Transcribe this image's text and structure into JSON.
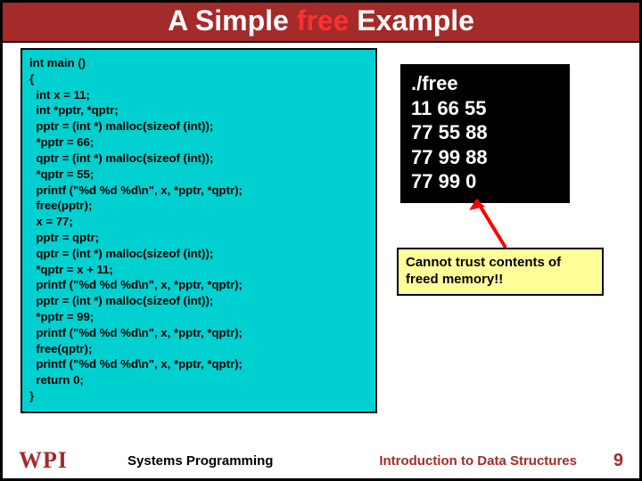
{
  "title": {
    "pre": "A Simple ",
    "hl": "free",
    "post": " Example"
  },
  "code": "int main ()\n{\n  int x = 11;\n  int *pptr, *qptr;\n  pptr = (int *) malloc(sizeof (int));\n  *pptr = 66;\n  qptr = (int *) malloc(sizeof (int));\n  *qptr = 55;\n  printf (\"%d %d %d\\n\", x, *pptr, *qptr);\n  free(pptr);\n  x = 77;\n  pptr = qptr;\n  qptr = (int *) malloc(sizeof (int));\n  *qptr = x + 11;\n  printf (\"%d %d %d\\n\", x, *pptr, *qptr);\n  pptr = (int *) malloc(sizeof (int));\n  *pptr = 99;\n  printf (\"%d %d %d\\n\", x, *pptr, *qptr);\n  free(qptr);\n  printf (\"%d %d %d\\n\", x, *pptr, *qptr);\n  return 0;\n}",
  "output": "./free\n11 66 55\n77 55 88\n77 99 88\n77 99 0",
  "callout": "Cannot trust contents of freed memory!!",
  "footer": {
    "logo": "WPI",
    "center": "Systems Programming",
    "right": "Introduction to Data Structures",
    "page": "9"
  }
}
